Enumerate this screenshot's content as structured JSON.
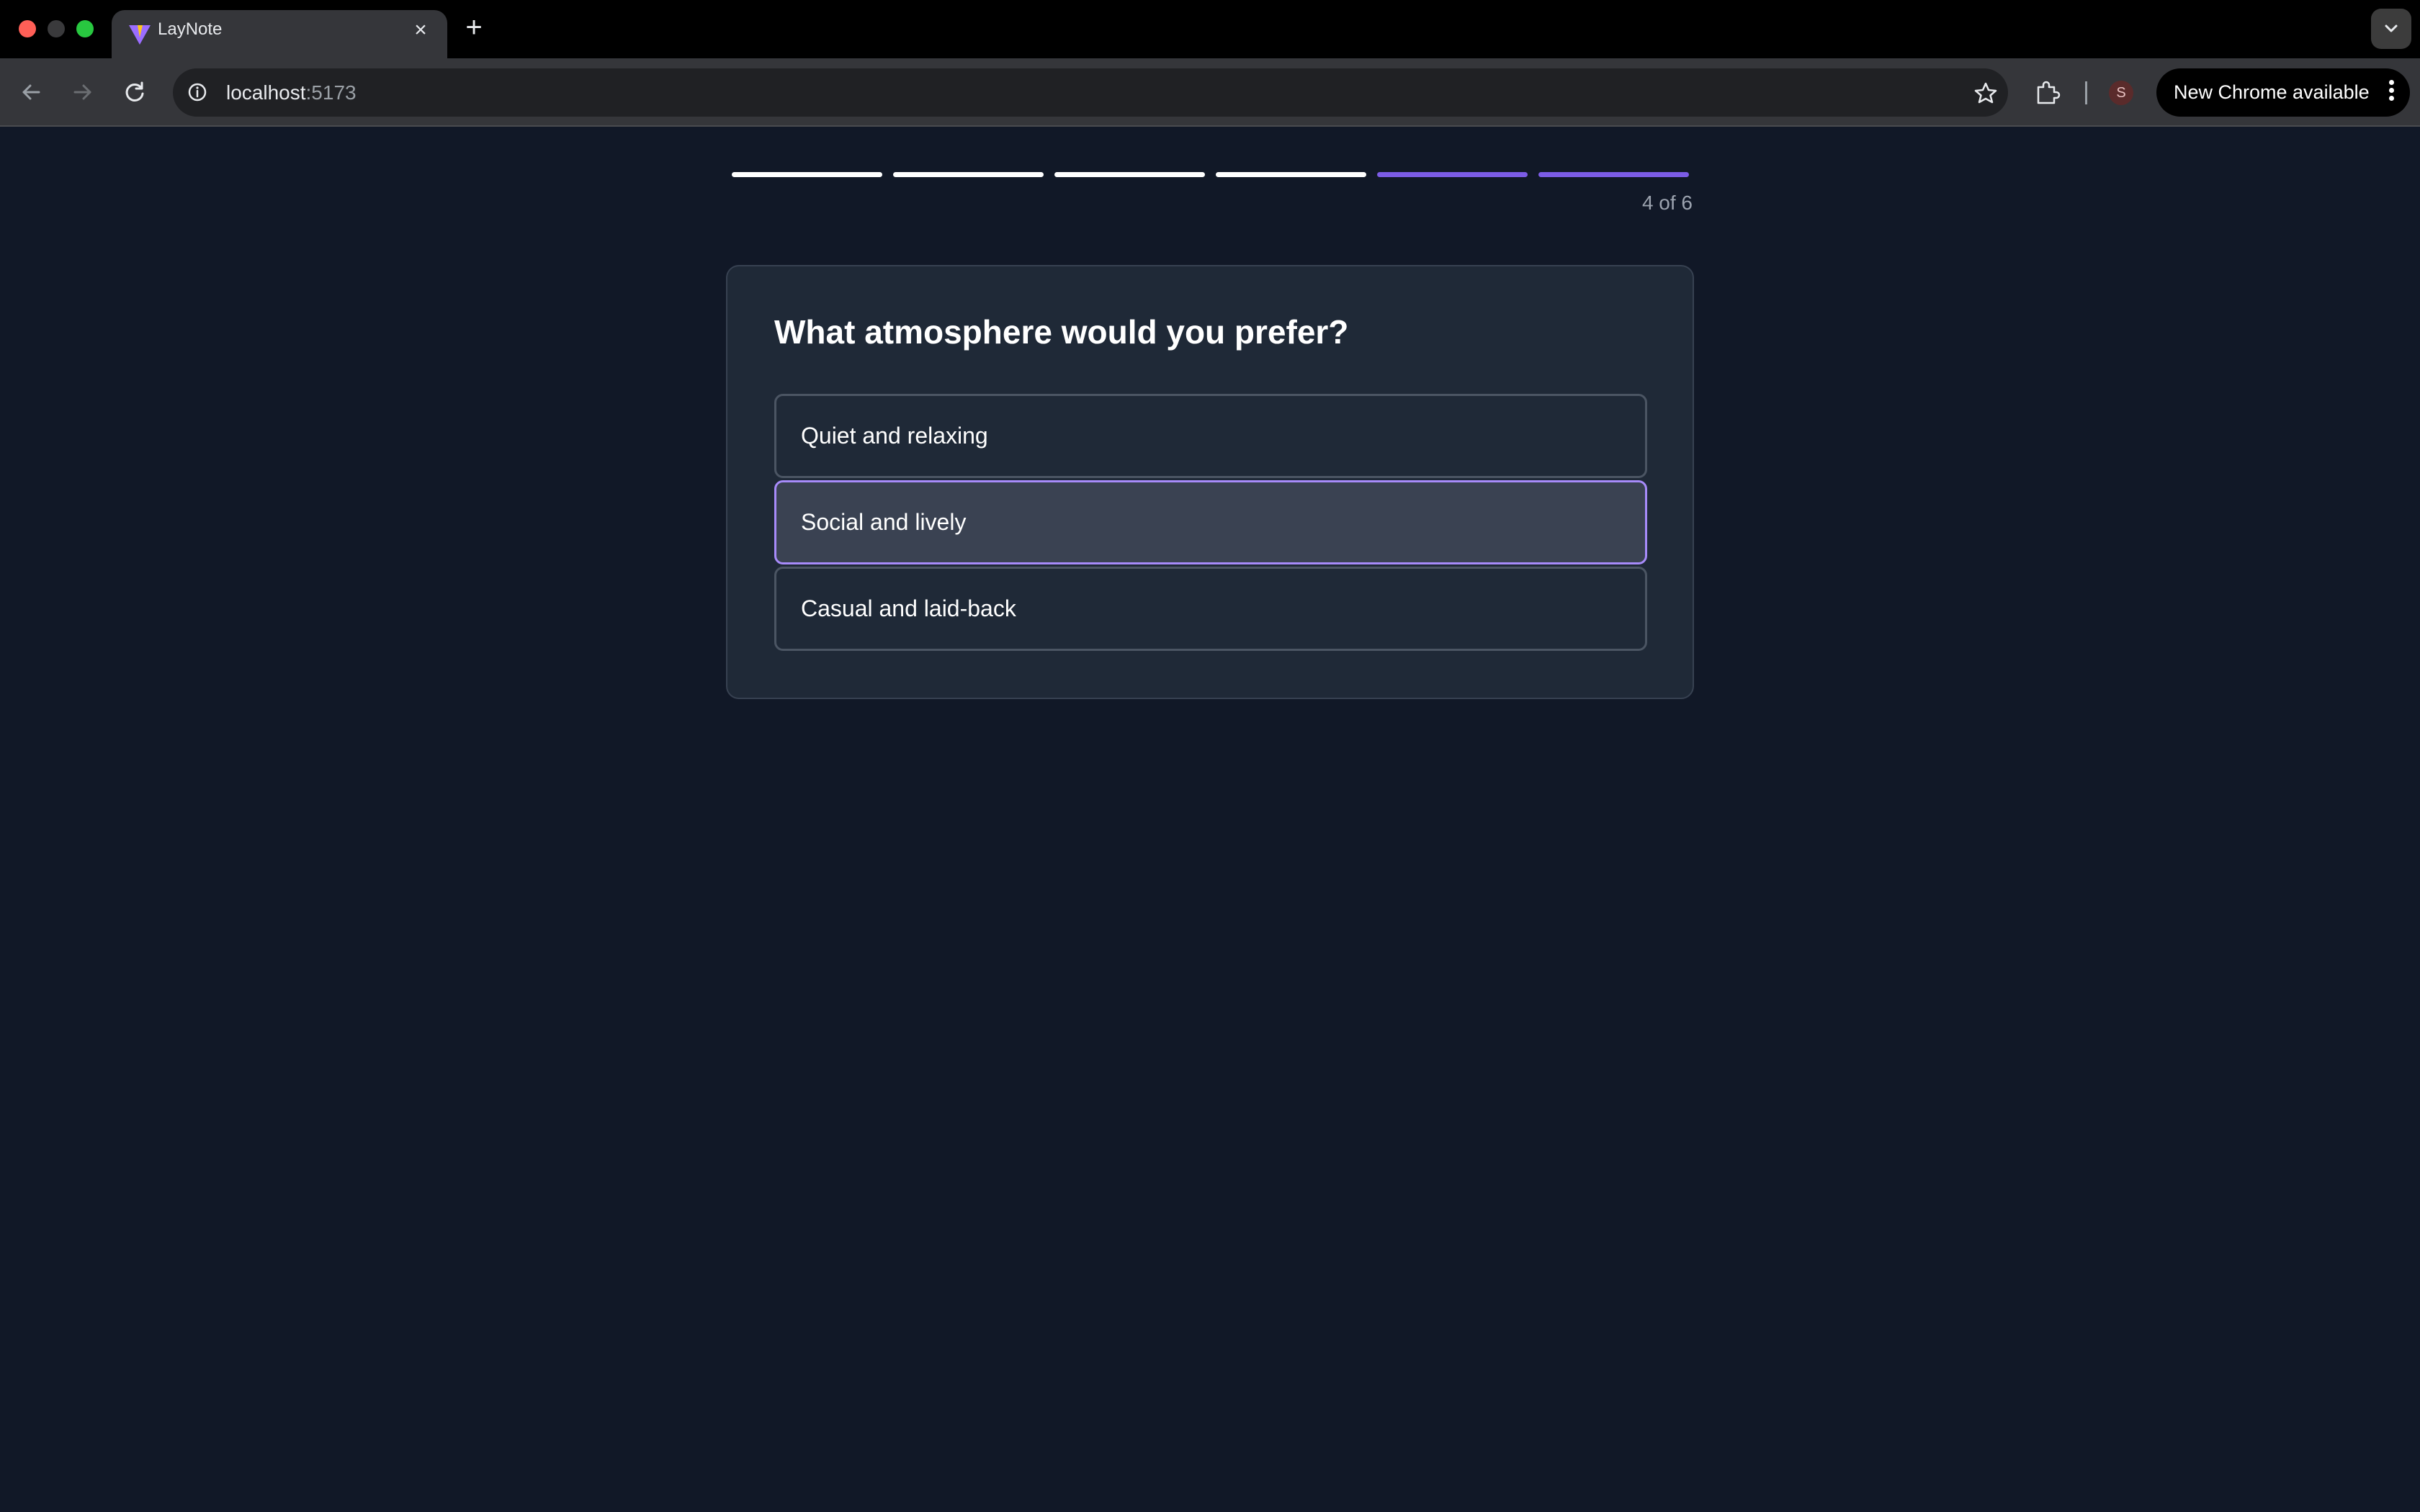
{
  "browser": {
    "tab_title": "LayNote",
    "url_host": "localhost",
    "url_port": ":5173",
    "profile_initial": "S",
    "update_label": "New Chrome available",
    "icons": [
      "vite-favicon-icon",
      "close-icon",
      "plus-icon",
      "chevron-down-icon",
      "back-arrow-icon",
      "forward-arrow-icon",
      "reload-icon",
      "info-icon",
      "star-icon",
      "extensions-puzzle-icon",
      "kebab-menu-icon"
    ]
  },
  "quiz": {
    "progress": {
      "total_steps": 6,
      "completed_steps": 4
    },
    "step_counter": "4 of 6",
    "question": "What atmosphere would you prefer?",
    "options": [
      {
        "label": "Quiet and relaxing",
        "selected": false
      },
      {
        "label": "Social and lively",
        "selected": true
      },
      {
        "label": "Casual and laid-back",
        "selected": false
      }
    ]
  },
  "colors": {
    "page_bg": "#111827",
    "card_bg": "#1f2937",
    "accent": "#7c5ce6",
    "selected_border": "#a78bfa"
  }
}
